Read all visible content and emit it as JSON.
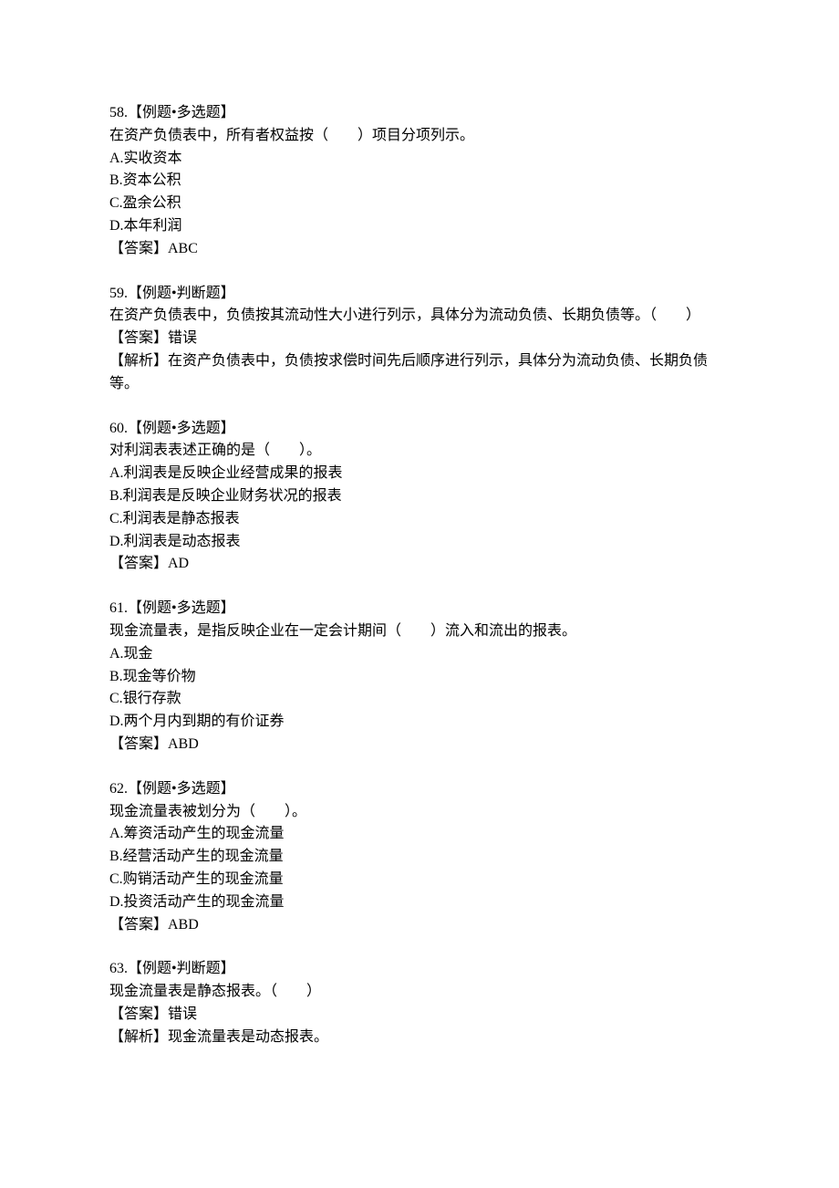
{
  "questions": [
    {
      "header": "58.【例题•多选题】",
      "stem": "在资产负债表中，所有者权益按（　　）项目分项列示。",
      "options": [
        "A.实收资本",
        "B.资本公积",
        "C.盈余公积",
        "D.本年利润"
      ],
      "answer": "【答案】ABC",
      "analysis": ""
    },
    {
      "header": "59.【例题•判断题】",
      "stem": "在资产负债表中，负债按其流动性大小进行列示，具体分为流动负债、长期负债等。（　　）",
      "options": [],
      "answer": "【答案】错误",
      "analysis": "【解析】在资产负债表中，负债按求偿时间先后顺序进行列示，具体分为流动负债、长期负债等。"
    },
    {
      "header": "60.【例题•多选题】",
      "stem": "对利润表表述正确的是（　　）。",
      "options": [
        "A.利润表是反映企业经营成果的报表",
        "B.利润表是反映企业财务状况的报表",
        "C.利润表是静态报表",
        "D.利润表是动态报表"
      ],
      "answer": "【答案】AD",
      "analysis": ""
    },
    {
      "header": "61.【例题•多选题】",
      "stem": "现金流量表，是指反映企业在一定会计期间（　　）流入和流出的报表。",
      "options": [
        "A.现金",
        "B.现金等价物",
        "C.银行存款",
        "D.两个月内到期的有价证券"
      ],
      "answer": "【答案】ABD",
      "analysis": ""
    },
    {
      "header": "62.【例题•多选题】",
      "stem": "现金流量表被划分为（　　）。",
      "options": [
        "A.筹资活动产生的现金流量",
        "B.经营活动产生的现金流量",
        "C.购销活动产生的现金流量",
        "D.投资活动产生的现金流量"
      ],
      "answer": "【答案】ABD",
      "analysis": ""
    },
    {
      "header": "63.【例题•判断题】",
      "stem": "现金流量表是静态报表。（　　）",
      "options": [],
      "answer": "【答案】错误",
      "analysis": "【解析】现金流量表是动态报表。"
    }
  ]
}
